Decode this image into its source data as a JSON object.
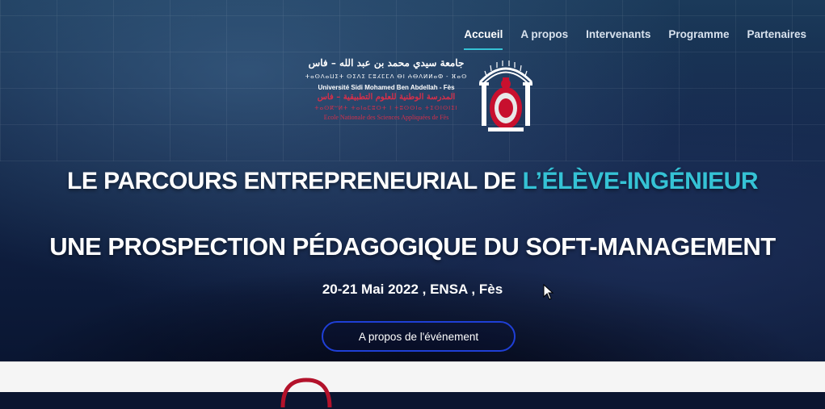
{
  "nav": {
    "items": [
      {
        "label": "Accueil",
        "active": true
      },
      {
        "label": "A propos",
        "active": false
      },
      {
        "label": "Intervenants",
        "active": false
      },
      {
        "label": "Programme",
        "active": false
      },
      {
        "label": "Partenaires",
        "active": false
      }
    ]
  },
  "logo": {
    "arabic_university": "جامعة سيدي محمد بن عبد الله – فاس",
    "tifinagh_university": "ⵜⴰⵙⴷⴰⵡⵉⵜ ⵙⵉⴷⵉ ⵎⵓⵃⵎⵎⴷ ⴱⵏ ⵄⴱⴷⵍⵍⴰⵀ - ⴼⴰⵙ",
    "french_university": "Université Sidi Mohamed Ben Abdellah - Fès",
    "arabic_school": "المدرسة الوطنية للعلوم التطبيقية – فاس",
    "tifinagh_school": "ⵜⴰⵙⴽⵯⵍⵜ ⵜⴰⵏⴰⵎⵓⵔⵜ ⵏ ⵜⵓⵙⵙⵏⴰ ⵜⵉⵙⵏⵙⵏⵉⵏ",
    "french_school": "Ecole Nationale des Sciences Appliquées de Fès"
  },
  "hero": {
    "title_line1_main": "LE PARCOURS ENTREPRENEURIAL DE ",
    "title_line1_accent": "L’ÉLÈVE-INGÉNIEUR",
    "title_line2": "UNE PROSPECTION PÉDAGOGIQUE DU SOFT-MANAGEMENT",
    "date": "20-21 Mai 2022 , ENSA , Fès",
    "cta_label": "A propos de l'événement"
  },
  "colors": {
    "accent": "#35c2d5",
    "cta_border": "#1f3fd6",
    "logo_red": "#d72f4a"
  }
}
